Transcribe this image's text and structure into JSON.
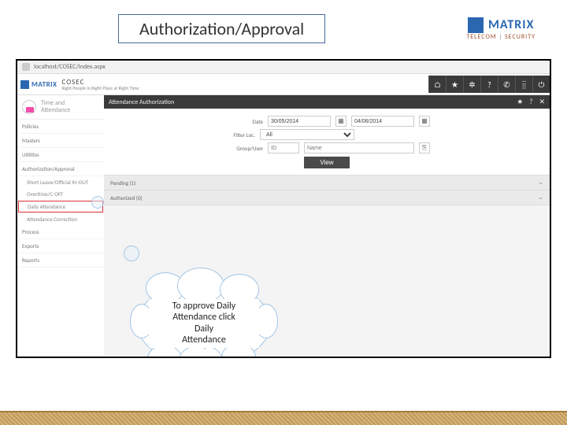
{
  "slide": {
    "title": "Authorization/Approval",
    "logo_brand": "MATRIX",
    "logo_tagline_a": "TELECOM",
    "logo_tagline_b": "SECURITY"
  },
  "browser": {
    "url": "localhost/COSEC/Index.aspx"
  },
  "app": {
    "brand": "MATRIX",
    "name": "COSEC",
    "tagline": "Right People in Right Place at Right Time",
    "header_icons": {
      "home": "⌂",
      "star": "★",
      "gear": "✲",
      "help": "?",
      "phone": "✆",
      "grid": "⁞⁞",
      "power": "⏻"
    }
  },
  "sidebar": {
    "module_l1": "Time and",
    "module_l2": "Attendance",
    "items": {
      "policies": "Policies",
      "masters": "Masters",
      "utilities": "Utilities",
      "auth": "Authorization/Approval",
      "short_leave": "Short Leave/Official IN-OUT",
      "overtime": "Overtime/C-OFF",
      "daily_att": "Daily Attendance",
      "att_corr": "Attendance Correction",
      "process": "Process",
      "exports": "Exports",
      "reports": "Reports"
    }
  },
  "panel": {
    "title": "Attendance Authorization",
    "filters": {
      "date_label": "Date",
      "date_from": "30/05/2014",
      "date_to": "04/06/2014",
      "filter_label": "Filter Loc.",
      "filter_value": "All",
      "group_label": "Group/User",
      "group_id": "ID",
      "group_name": "Name"
    },
    "view_btn": "View",
    "pending": "Pending (1)",
    "authorized": "Authorized (0)"
  },
  "callout": {
    "l1": "To approve Daily",
    "l2": "Attendance click",
    "l3": "Daily",
    "l4": "Attendance"
  }
}
